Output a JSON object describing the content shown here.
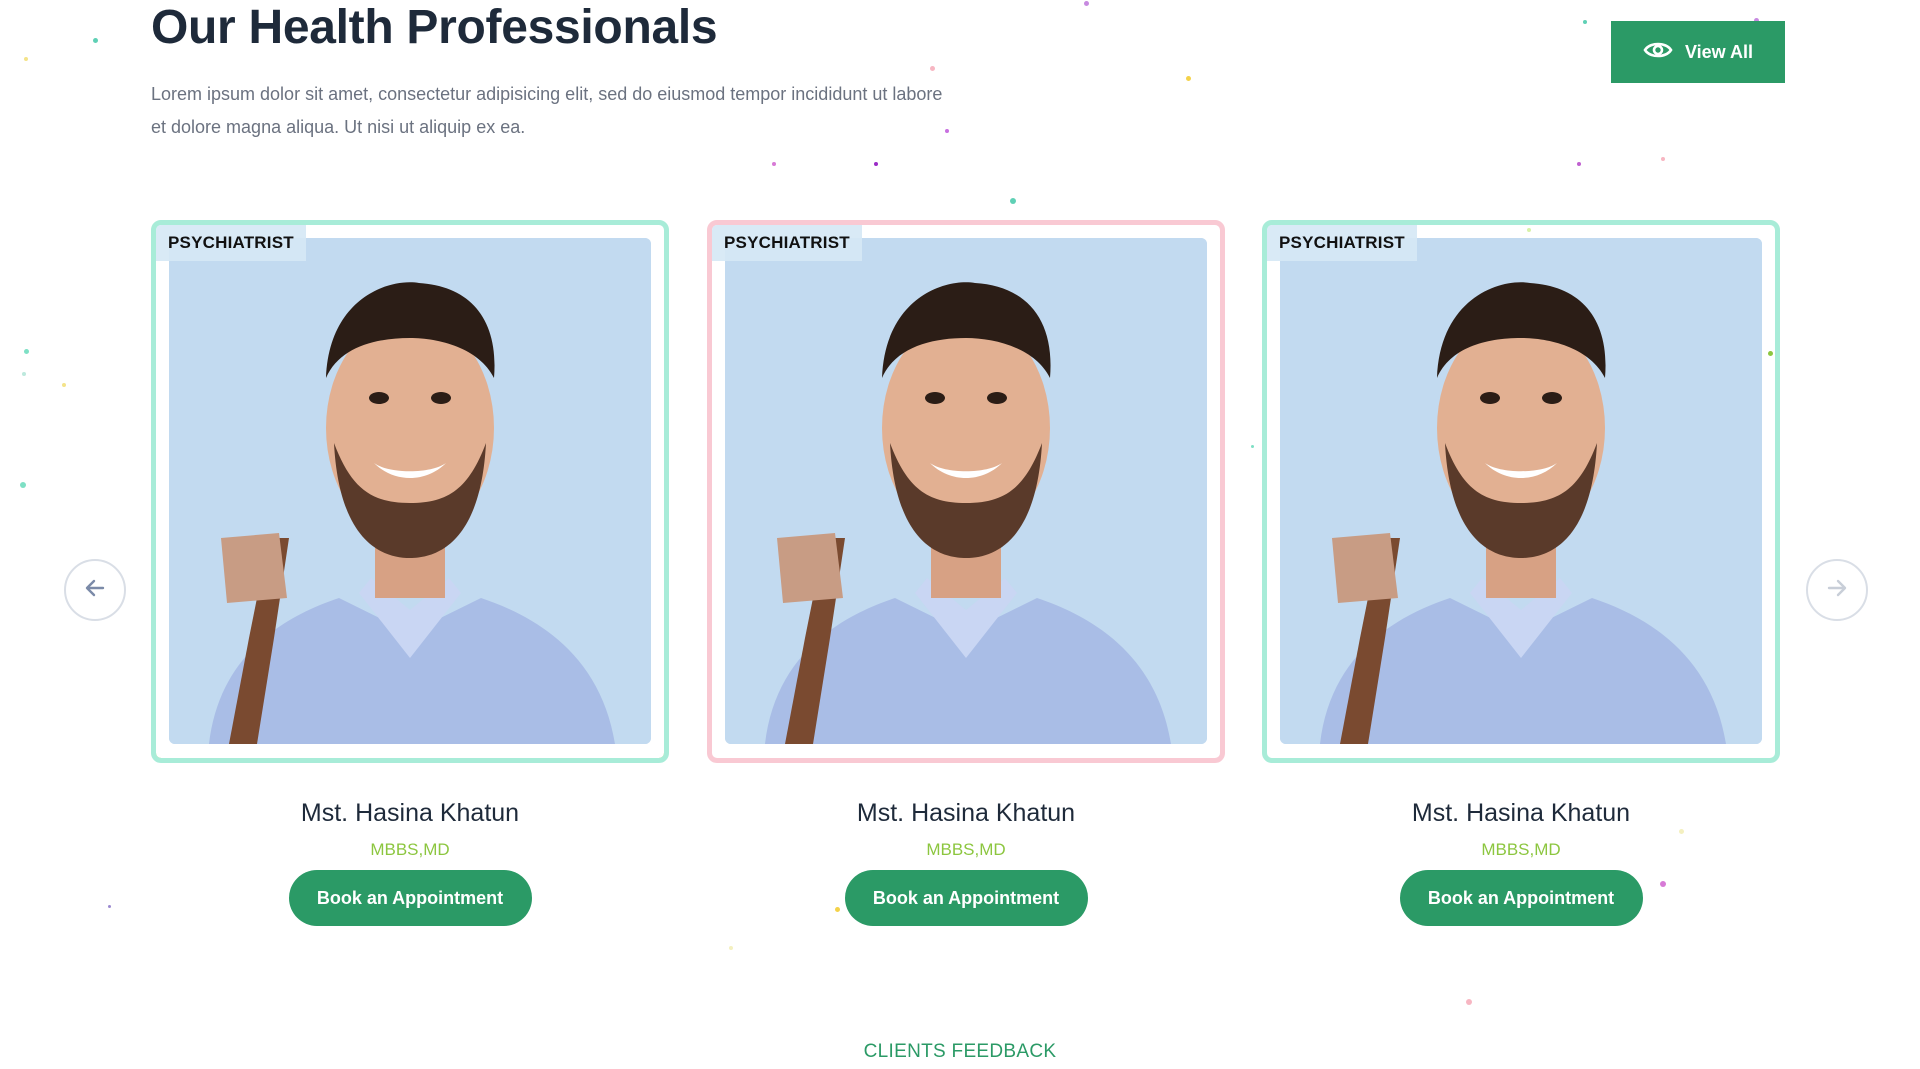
{
  "header": {
    "title": "Our Health Professionals",
    "description": "Lorem ipsum dolor sit amet, consectetur adipisicing elit, sed do eiusmod tempor incididunt ut labore et dolore magna aliqua. Ut nisi ut aliquip ex ea.",
    "view_all_label": "View All"
  },
  "carousel": {
    "prev_icon": "arrow-left-icon",
    "next_icon": "arrow-right-icon",
    "cards": [
      {
        "badge": "PSYCHIATRIST",
        "name": "Mst. Hasina Khatun",
        "degree": "MBBS,MD",
        "button": "Book an Appointment"
      },
      {
        "badge": "PSYCHIATRIST",
        "name": "Mst. Hasina Khatun",
        "degree": "MBBS,MD",
        "button": "Book an Appointment"
      },
      {
        "badge": "PSYCHIATRIST",
        "name": "Mst. Hasina Khatun",
        "degree": "MBBS,MD",
        "button": "Book an Appointment"
      }
    ]
  },
  "next_section": {
    "label": "CLIENTS FEEDBACK"
  },
  "colors": {
    "primary_green": "#2b9a66",
    "lime_accent": "#8cc63f",
    "mint_border": "#a8ecd8",
    "pink_border": "#f9c9d3",
    "heading": "#1e2a3a"
  }
}
